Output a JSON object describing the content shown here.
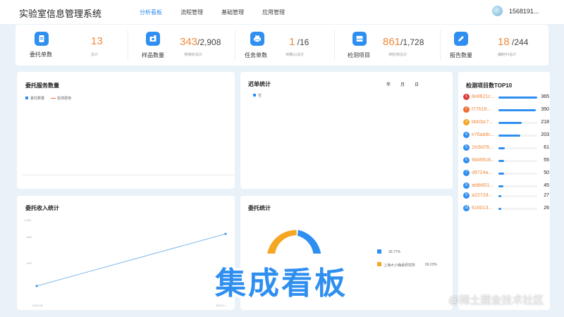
{
  "header": {
    "app_title": "实验室信息管理系统",
    "nav": [
      "分析看板",
      "流程管理",
      "基础管理",
      "应用管理"
    ],
    "user": "1568191..."
  },
  "stats": [
    {
      "icon": "document-icon",
      "label": "委托单数",
      "value": "13",
      "total": "",
      "sub": "总计"
    },
    {
      "icon": "sample-icon",
      "label": "样品数量",
      "value": "343",
      "total": "/2,908",
      "sub": "待接收/总计"
    },
    {
      "icon": "printer-icon",
      "label": "任务单数",
      "value": "1",
      "total": " /16",
      "sub": "待确认/总计"
    },
    {
      "icon": "inbox-icon",
      "label": "检测项目",
      "value": "861",
      "total": "/1,728",
      "sub": "待检测/总计"
    },
    {
      "icon": "pen-icon",
      "label": "报告数量",
      "value": "18",
      "total": " /244",
      "sub": "编制中/总计"
    }
  ],
  "panels": {
    "service": {
      "title": "委托服务数量",
      "legend": [
        "委托数量",
        "检测费用"
      ]
    },
    "backlog": {
      "title": "迟单统计",
      "tabs": [
        "年",
        "月",
        "日"
      ],
      "legend": [
        "空"
      ]
    },
    "income": {
      "title": "委托收入统计",
      "yticks": [
        "1,200",
        "800",
        "400"
      ],
      "xticks": [
        "2022-06",
        "2022-0..."
      ]
    },
    "commission": {
      "title": "委托统计",
      "legend": [
        {
          "label": "",
          "pct": "30.77%",
          "color": "#2f8ff0"
        },
        {
          "label": "上海大小嗨承研究所",
          "pct": "69.23%",
          "color": "#f5a623"
        }
      ]
    },
    "top10": {
      "title": "检测项目数TOP10"
    }
  },
  "top10": [
    {
      "rank": "1",
      "name": "8e8621c...",
      "value": 365,
      "color": "#e23b3b"
    },
    {
      "rank": "2",
      "name": "f7761ff...",
      "value": 350,
      "color": "#f06a2f"
    },
    {
      "rank": "3",
      "name": "bbfcbc7...",
      "value": 218,
      "color": "#f5a623"
    },
    {
      "rank": "4",
      "name": "e76ab6c...",
      "value": 203,
      "color": "#2f8ff0"
    },
    {
      "rank": "5",
      "name": "1fc6d78...",
      "value": 61,
      "color": "#2f8ff0"
    },
    {
      "rank": "6",
      "name": "9d495c8...",
      "value": 55,
      "color": "#2f8ff0"
    },
    {
      "rank": "7",
      "name": "d9724a...",
      "value": 50,
      "color": "#2f8ff0"
    },
    {
      "rank": "8",
      "name": "afdb601...",
      "value": 45,
      "color": "#2f8ff0"
    },
    {
      "rank": "9",
      "name": "a2272d...",
      "value": 27,
      "color": "#2f8ff0"
    },
    {
      "rank": "10",
      "name": "616013...",
      "value": 26,
      "color": "#2f8ff0"
    }
  ],
  "overlay": {
    "banner": "集成看板",
    "watermark": "@稀土掘金技术社区"
  },
  "colors": {
    "accent": "#2f8ff0",
    "highlight": "#f08a3c",
    "orange": "#f5a623"
  }
}
